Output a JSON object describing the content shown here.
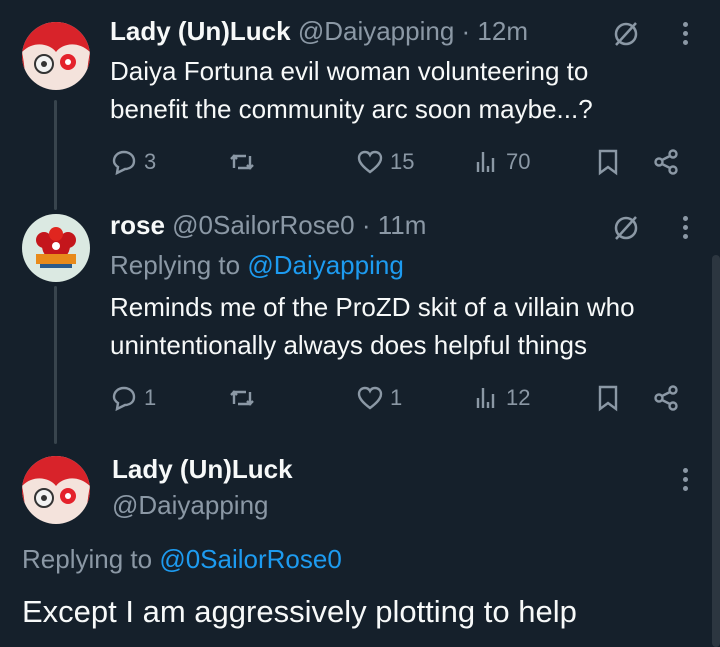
{
  "tweets": [
    {
      "display_name": "Lady (Un)Luck",
      "handle": "@Daiyapping",
      "time": "· 12m",
      "text_lines": [
        "Daiya Fortuna evil woman volunteering to",
        "benefit the community arc soon maybe...?"
      ],
      "stats": {
        "replies": "3",
        "reposts": "",
        "likes": "15",
        "views": "70"
      }
    },
    {
      "display_name": "rose",
      "handle": "@0SailorRose0",
      "time": "· 11m",
      "replying_label": "Replying to",
      "replying_handle": "@Daiyapping",
      "text_lines": [
        "Reminds me of the ProZD skit of a villain who",
        "unintentionally always does helpful things"
      ],
      "stats": {
        "replies": "1",
        "reposts": "",
        "likes": "1",
        "views": "12"
      }
    },
    {
      "display_name": "Lady (Un)Luck",
      "handle": "@Daiyapping",
      "replying_label": "Replying to",
      "replying_handle": "@0SailorRose0",
      "text": "Except I am aggressively plotting to help"
    }
  ],
  "icons": [
    "avatar",
    "grok-slash-icon",
    "more-icon",
    "reply-icon",
    "repost-icon",
    "like-icon",
    "views-icon",
    "bookmark-icon",
    "share-icon"
  ],
  "colors": {
    "background": "#15202b",
    "secondary_text": "#8b98a5",
    "link": "#1d9bf0",
    "thread_line": "#38444d"
  }
}
